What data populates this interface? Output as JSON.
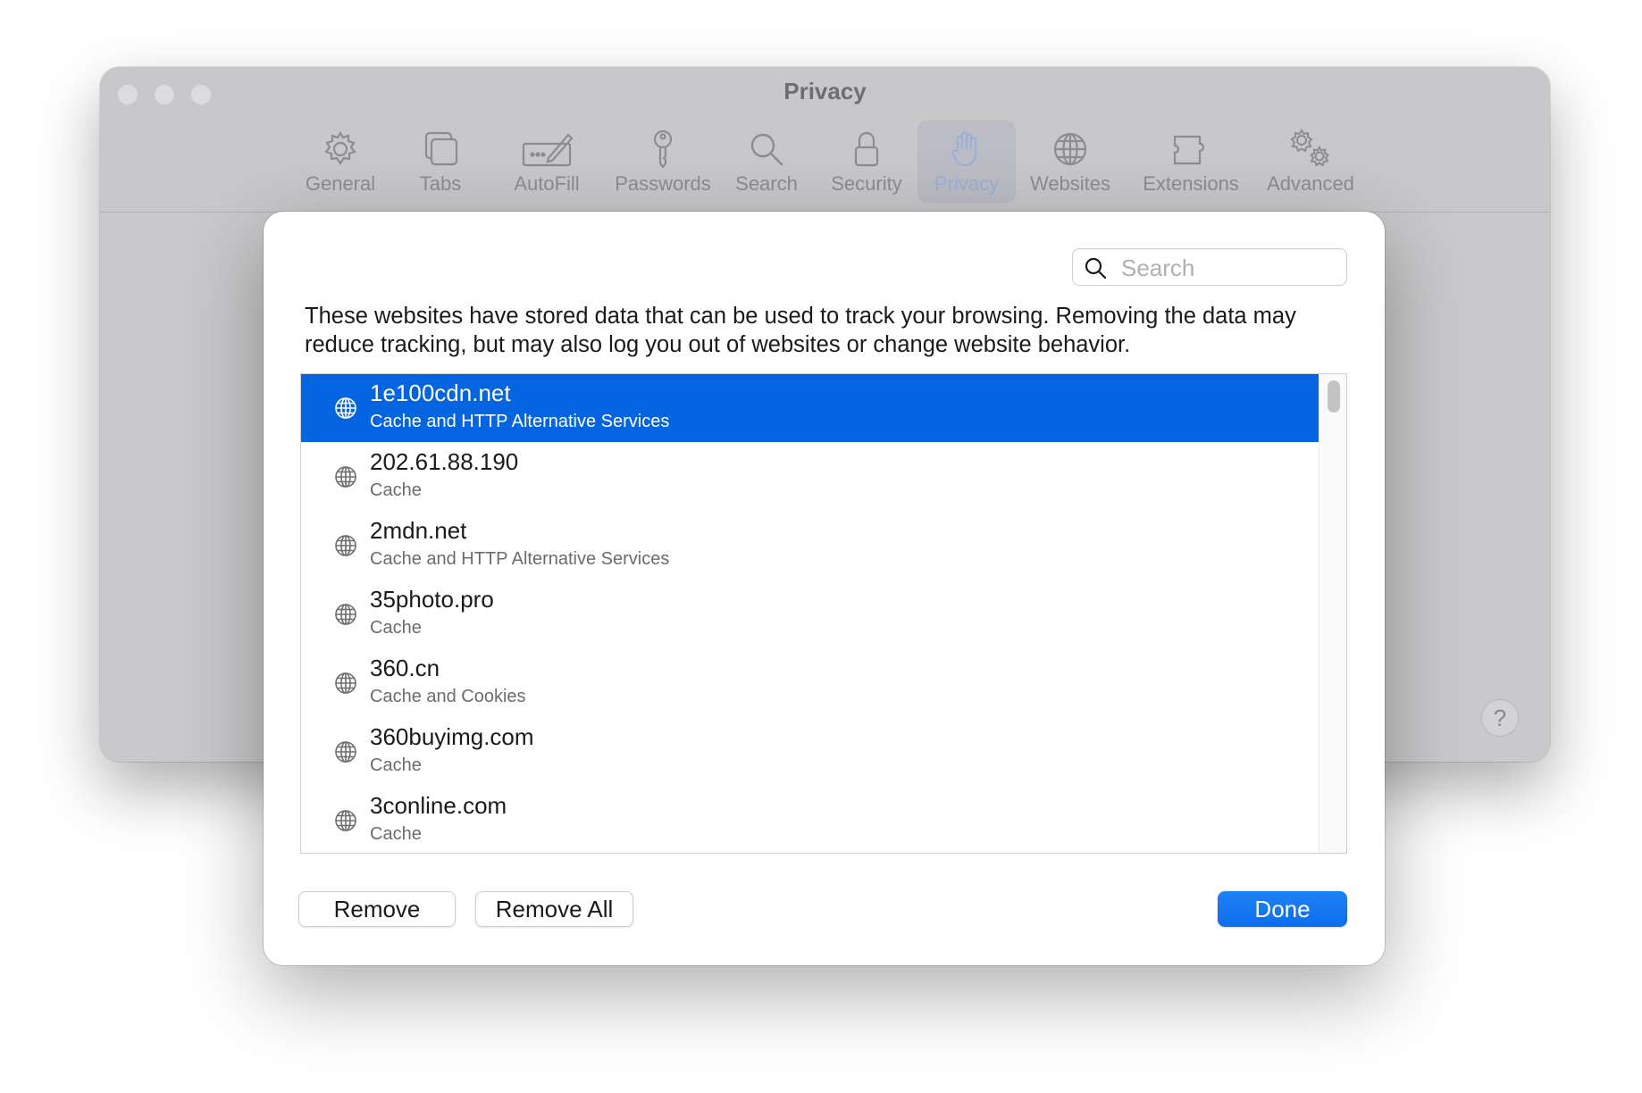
{
  "window": {
    "title": "Privacy",
    "toolbar": [
      {
        "label": "General",
        "icon": "gear-icon"
      },
      {
        "label": "Tabs",
        "icon": "tabs-icon"
      },
      {
        "label": "AutoFill",
        "icon": "autofill-icon"
      },
      {
        "label": "Passwords",
        "icon": "key-icon"
      },
      {
        "label": "Search",
        "icon": "search-icon"
      },
      {
        "label": "Security",
        "icon": "lock-icon"
      },
      {
        "label": "Privacy",
        "icon": "hand-icon",
        "active": true
      },
      {
        "label": "Websites",
        "icon": "globe-icon"
      },
      {
        "label": "Extensions",
        "icon": "puzzle-icon"
      },
      {
        "label": "Advanced",
        "icon": "gears-icon"
      }
    ],
    "help_label": "?"
  },
  "sheet": {
    "search_placeholder": "Search",
    "description": "These websites have stored data that can be used to track your browsing. Removing the data may reduce tracking, but may also log you out of websites or change website behavior.",
    "websites": [
      {
        "site": "1e100cdn.net",
        "data": "Cache and HTTP Alternative Services",
        "selected": true
      },
      {
        "site": "202.61.88.190",
        "data": "Cache"
      },
      {
        "site": "2mdn.net",
        "data": "Cache and HTTP Alternative Services"
      },
      {
        "site": "35photo.pro",
        "data": "Cache"
      },
      {
        "site": "360.cn",
        "data": "Cache and Cookies"
      },
      {
        "site": "360buyimg.com",
        "data": "Cache"
      },
      {
        "site": "3conline.com",
        "data": "Cache"
      }
    ],
    "buttons": {
      "remove": "Remove",
      "remove_all": "Remove All",
      "done": "Done"
    },
    "colors": {
      "selection": "#0564e0",
      "done_button": "#1477f2"
    }
  }
}
